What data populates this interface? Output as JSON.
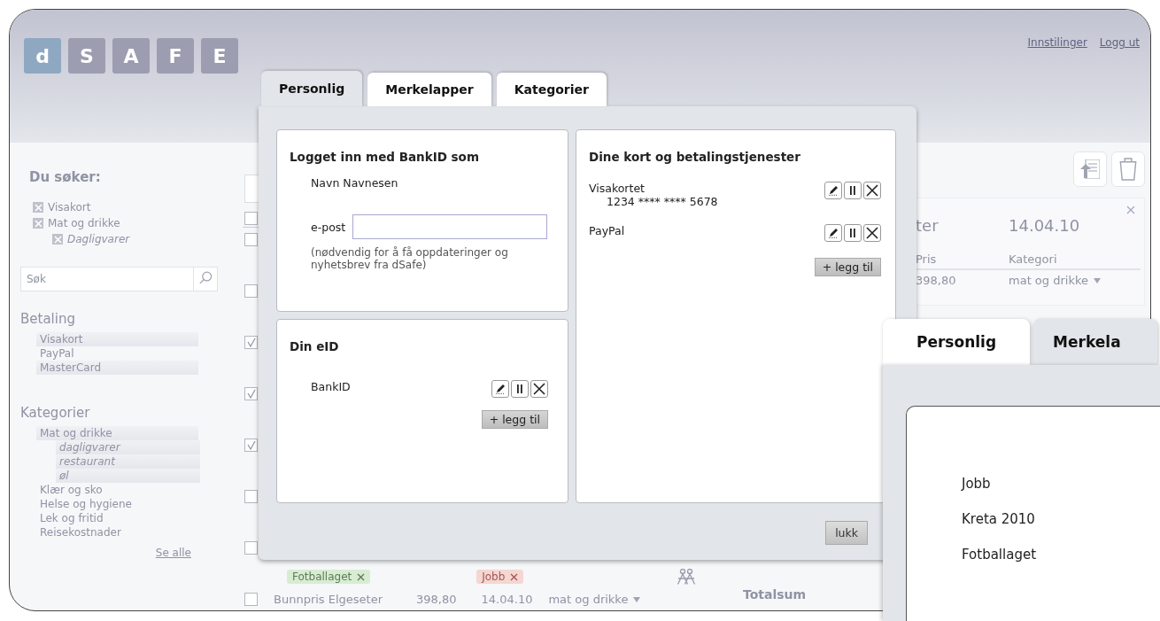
{
  "header": {
    "logo_letters": [
      {
        "letter": "d",
        "highlighted": true
      },
      {
        "letter": "S",
        "highlighted": false
      },
      {
        "letter": "A",
        "highlighted": false
      },
      {
        "letter": "F",
        "highlighted": false
      },
      {
        "letter": "E",
        "highlighted": false
      }
    ],
    "links": [
      "Innstilinger",
      "Logg ut"
    ]
  },
  "sidebar": {
    "search_title": "Du søker:",
    "active_filters": [
      {
        "label": "Visakort",
        "checked": true
      },
      {
        "label": "Mat og drikke",
        "checked": true,
        "children": [
          {
            "label": "Dagligvarer",
            "checked": true
          }
        ]
      }
    ],
    "search": {
      "placeholder": "Søk"
    },
    "payment": {
      "title": "Betaling",
      "items": [
        {
          "label": "Visakort",
          "selected": true
        },
        {
          "label": "PayPal",
          "selected": false
        },
        {
          "label": "MasterCard",
          "selected": true
        }
      ]
    },
    "categories": {
      "title": "Kategorier",
      "items": [
        {
          "label": "Mat og drikke",
          "selected": true,
          "children": [
            {
              "label": "dagligvarer",
              "selected": true
            },
            {
              "label": "restaurant",
              "selected": true
            },
            {
              "label": "øl",
              "selected": true
            }
          ]
        },
        {
          "label": "Klær og sko",
          "selected": false
        },
        {
          "label": "Helse og hygiene",
          "selected": false
        },
        {
          "label": "Lek og fritid",
          "selected": false
        },
        {
          "label": "Reisekostnader",
          "selected": false
        }
      ]
    },
    "see_all": "Se alle"
  },
  "list": {
    "header_checked": false,
    "rows": [
      {
        "checked": false
      },
      {
        "checked": false
      },
      {
        "checked": true
      },
      {
        "checked": true
      },
      {
        "checked": true
      },
      {
        "checked": false
      },
      {
        "checked": false,
        "tags": [
          {
            "label": "Fotballaget",
            "color": "#d8ecd2"
          },
          {
            "label": "Jobb",
            "color": "#f6d6d2"
          }
        ]
      },
      {
        "checked": false,
        "name": "Bunnpris Elgeseter",
        "price": "398,80",
        "date": "14.04.10",
        "category": "mat og drikke"
      }
    ]
  },
  "detail": {
    "title": "ter",
    "date": "14.04.10",
    "columns": [
      "Pris",
      "Kategori"
    ],
    "row": {
      "price": "398,80",
      "category": "mat og drikke"
    },
    "total_label": "Totalsum"
  },
  "dialog": {
    "tabs": [
      {
        "label": "Personlig",
        "selected": true
      },
      {
        "label": "Merkelapper",
        "selected": false
      },
      {
        "label": "Kategorier",
        "selected": false
      }
    ],
    "login": {
      "title": "Logget inn med BankID som",
      "name": "Navn Navnesen",
      "email_label": "e-post",
      "note": "(nødvendig for å få oppdateringer og nyhetsbrev fra dSafe)"
    },
    "eid": {
      "title": "Din eID",
      "items": [
        {
          "name": "BankID"
        }
      ],
      "add": "+ legg til"
    },
    "cards": {
      "title": "Dine kort og betalingstjenester",
      "items": [
        {
          "name": "Visakortet",
          "number": "1234 **** **** 5678"
        },
        {
          "name": "PayPal"
        }
      ],
      "add": "+ legg til"
    },
    "close": "lukk"
  },
  "inset": {
    "tabs": [
      {
        "label": "Personlig",
        "selected": false
      },
      {
        "label": "Merkela",
        "selected": true
      }
    ],
    "tags": [
      "Jobb",
      "Kreta 2010",
      "Fotballaget"
    ]
  }
}
